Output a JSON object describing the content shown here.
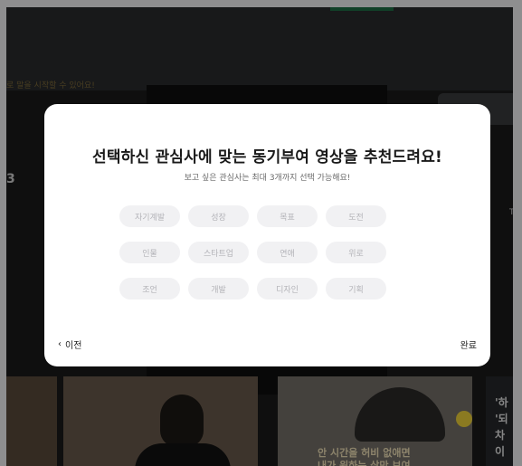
{
  "background": {
    "subtitle": "로 말을 시작할 수 있어요!",
    "left_number": "3",
    "right_label": "T",
    "thumb_right_text": "'하\n'되\n차이",
    "thumb_mid_text": "안 시간을 허비 없애면\n내가 원하는 삶만 보여"
  },
  "modal": {
    "title": "선택하신 관심사에 맞는 동기부여 영상을 추천드려요!",
    "subtitle": "보고 싶은 관심사는 최대 3개까지 선택 가능해요!",
    "chips": [
      "자기계발",
      "성장",
      "목표",
      "도전",
      "인물",
      "스타트업",
      "연애",
      "위로",
      "조언",
      "개발",
      "디자인",
      "기획"
    ],
    "prev_label": "이전",
    "done_label": "완료"
  },
  "colors": {
    "accent_green": "#1f6f45",
    "chip_bg": "#f1f1f3",
    "chip_text": "#b3b3b8"
  }
}
